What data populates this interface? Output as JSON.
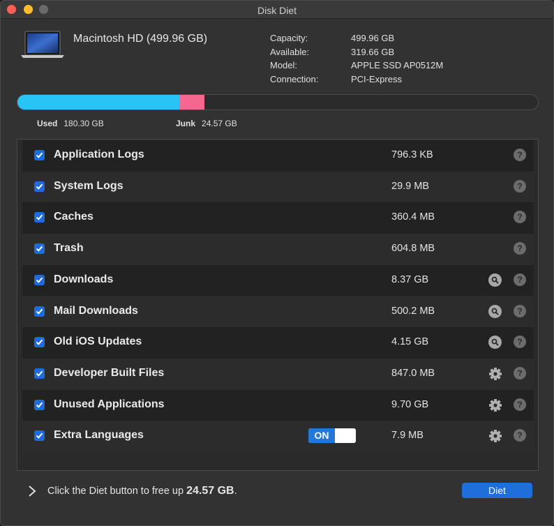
{
  "window": {
    "title": "Disk Diet"
  },
  "drive": {
    "name": "Macintosh HD (499.96 GB)",
    "info": [
      {
        "label": "Capacity:",
        "value": "499.96 GB"
      },
      {
        "label": "Available:",
        "value": "319.66 GB"
      },
      {
        "label": "Model:",
        "value": "APPLE SSD AP0512M"
      },
      {
        "label": "Connection:",
        "value": "PCI-Express"
      }
    ]
  },
  "usage": {
    "used_label": "Used",
    "used_value": "180.30 GB",
    "junk_label": "Junk",
    "junk_value": "24.57 GB",
    "used_fraction": 0.3106,
    "junk_fraction": 0.0486,
    "used_color": "#29c4f6",
    "junk_color": "#f5678f"
  },
  "items": [
    {
      "label": "Application Logs",
      "size": "796.3 KB",
      "checked": true,
      "action_icon": "none"
    },
    {
      "label": "System Logs",
      "size": "29.9 MB",
      "checked": true,
      "action_icon": "none"
    },
    {
      "label": "Caches",
      "size": "360.4 MB",
      "checked": true,
      "action_icon": "none"
    },
    {
      "label": "Trash",
      "size": "604.8 MB",
      "checked": true,
      "action_icon": "none"
    },
    {
      "label": "Downloads",
      "size": "8.37 GB",
      "checked": true,
      "action_icon": "magnifier-icon"
    },
    {
      "label": "Mail Downloads",
      "size": "500.2 MB",
      "checked": true,
      "action_icon": "magnifier-icon"
    },
    {
      "label": "Old iOS Updates",
      "size": "4.15 GB",
      "checked": true,
      "action_icon": "magnifier-icon"
    },
    {
      "label": "Developer Built Files",
      "size": "847.0 MB",
      "checked": true,
      "action_icon": "gear-icon"
    },
    {
      "label": "Unused Applications",
      "size": "9.70 GB",
      "checked": true,
      "action_icon": "gear-icon"
    },
    {
      "label": "Extra Languages",
      "size": "7.9 MB",
      "checked": true,
      "action_icon": "gear-icon",
      "toggle": "ON"
    }
  ],
  "help_glyph": "?",
  "footer": {
    "message": "Click the Diet button to free up ",
    "amount": "24.57 GB",
    "suffix": ".",
    "diet_label": "Diet"
  },
  "colors": {
    "accent": "#1e6fd9",
    "checkbox": "#1d6bdc"
  }
}
